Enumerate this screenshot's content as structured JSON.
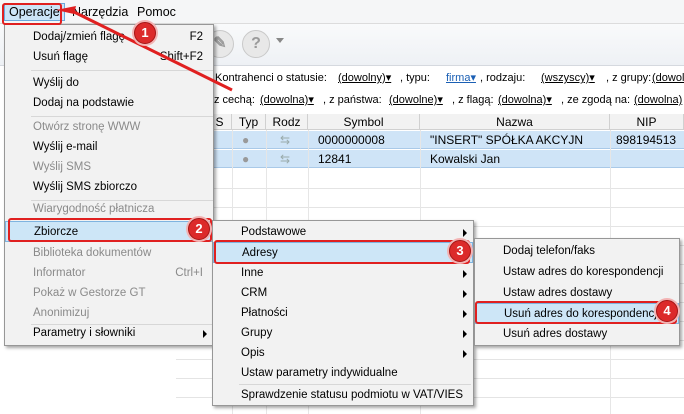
{
  "menubar": {
    "items": [
      "Operacje",
      "Narzędzia",
      "Pomoc"
    ]
  },
  "toolbar": {
    "icons": [
      "tool-icon",
      "help-icon"
    ]
  },
  "filters": {
    "row1": {
      "label_status": "Kontrahenci o statusie:",
      "status": "(dowolny)",
      "label_typ": ", typu:",
      "typ": "firma",
      "label_rodzaj": ", rodzaju:",
      "rodzaj": "(wszyscy)",
      "label_grupy": ", z grupy:",
      "grupy": "(dowolr"
    },
    "row2": {
      "label_cecha": "z cechą:",
      "cecha": "(dowolna)",
      "label_panstwa": ", z państwa:",
      "panstwa": "(dowolne)",
      "label_flaga": ", z flagą:",
      "flaga": "(dowolna)",
      "label_zgoda": ", ze zgodą na:",
      "zgoda": "(dowolna)"
    }
  },
  "grid": {
    "columns": [
      "S",
      "Typ",
      "Rodz",
      "Symbol",
      "Nazwa",
      "NIP"
    ],
    "rows": [
      {
        "symbol": "0000000008",
        "nazwa": "\"INSERT\" SPÓŁKA AKCYJN",
        "nip": "898194513"
      },
      {
        "symbol": "12841",
        "nazwa": "Kowalski Jan",
        "nip": ""
      }
    ]
  },
  "menu_operacje": {
    "items": [
      {
        "label": "Dodaj/zmień flagę",
        "shortcut": "F2",
        "disabled": false
      },
      {
        "label": "Usuń flagę",
        "shortcut": "Shift+F2",
        "disabled": false
      },
      {
        "label": "Wyślij do",
        "shortcut": "",
        "disabled": false
      },
      {
        "label": "Dodaj na podstawie",
        "shortcut": "",
        "disabled": false
      },
      {
        "label": "Otwórz stronę WWW",
        "shortcut": "",
        "disabled": true
      },
      {
        "label": "Wyślij e-mail",
        "shortcut": "",
        "disabled": false
      },
      {
        "label": "Wyślij SMS",
        "shortcut": "",
        "disabled": true
      },
      {
        "label": "Wyślij SMS zbiorczo",
        "shortcut": "",
        "disabled": false
      },
      {
        "label": "Wiarygodność płatnicza",
        "shortcut": "",
        "disabled": true
      },
      {
        "label": "Zbiorcze",
        "shortcut": "",
        "disabled": false
      },
      {
        "label": "Biblioteka dokumentów",
        "shortcut": "",
        "disabled": true
      },
      {
        "label": "Informator",
        "shortcut": "Ctrl+I",
        "disabled": true
      },
      {
        "label": "Pokaż w Gestorze GT",
        "shortcut": "",
        "disabled": true
      },
      {
        "label": "Anonimizuj",
        "shortcut": "",
        "disabled": true
      },
      {
        "label": "Parametry i słowniki",
        "shortcut": "",
        "disabled": false
      }
    ]
  },
  "menu_zbiorcze": {
    "items": [
      "Podstawowe",
      "Adresy",
      "Inne",
      "CRM",
      "Płatności",
      "Grupy",
      "Opis",
      "Ustaw parametry indywidualne",
      "Sprawdzenie statusu podmiotu w VAT/VIES"
    ]
  },
  "menu_adresy": {
    "items": [
      "Dodaj telefon/faks",
      "Ustaw adres do korespondencji",
      "Ustaw adres dostawy",
      "Usuń adres do korespondencji",
      "Usuń adres dostawy"
    ]
  },
  "badges": [
    "1",
    "2",
    "3",
    "4"
  ],
  "colors": {
    "highlight": "#cde6f7",
    "annotation": "#e02020",
    "selected_row": "#cfe4f7"
  }
}
